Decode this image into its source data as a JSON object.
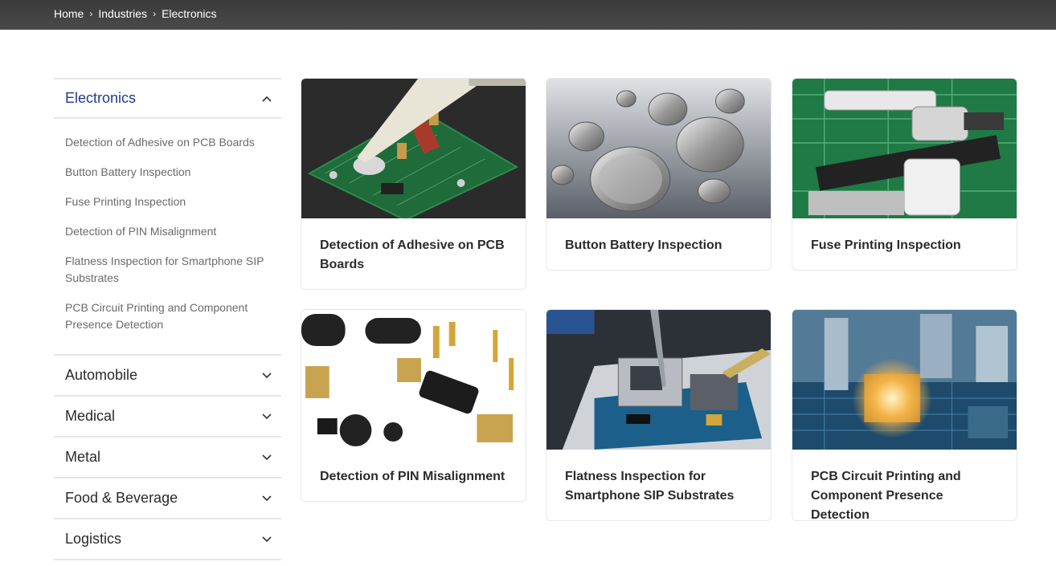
{
  "breadcrumb": {
    "items": [
      "Home",
      "Industries",
      "Electronics"
    ]
  },
  "sidebar": {
    "active": {
      "label": "Electronics",
      "subitems": [
        "Detection of Adhesive on PCB Boards",
        "Button Battery Inspection",
        "Fuse Printing Inspection",
        "Detection of PIN Misalignment",
        "Flatness Inspection for Smartphone SIP Substrates",
        "PCB Circuit Printing and Component Presence Detection"
      ]
    },
    "categories": [
      "Automobile",
      "Medical",
      "Metal",
      "Food & Beverage",
      "Logistics"
    ]
  },
  "cards": [
    {
      "title": "Detection of Adhesive on PCB Boards"
    },
    {
      "title": "Button Battery Inspection"
    },
    {
      "title": "Fuse Printing Inspection"
    },
    {
      "title": "Detection of PIN Misalignment"
    },
    {
      "title": "Flatness Inspection for Smartphone SIP Substrates"
    },
    {
      "title": "PCB Circuit Printing and Component Presence Detection"
    }
  ],
  "colors": {
    "topbar": "#454545",
    "active_category": "#1f3a93",
    "pcb_green": "#1f6b3a"
  },
  "icons": {
    "breadcrumb_separator": "chevron-right-icon",
    "expanded": "chevron-up-icon",
    "collapsed": "chevron-down-icon"
  }
}
